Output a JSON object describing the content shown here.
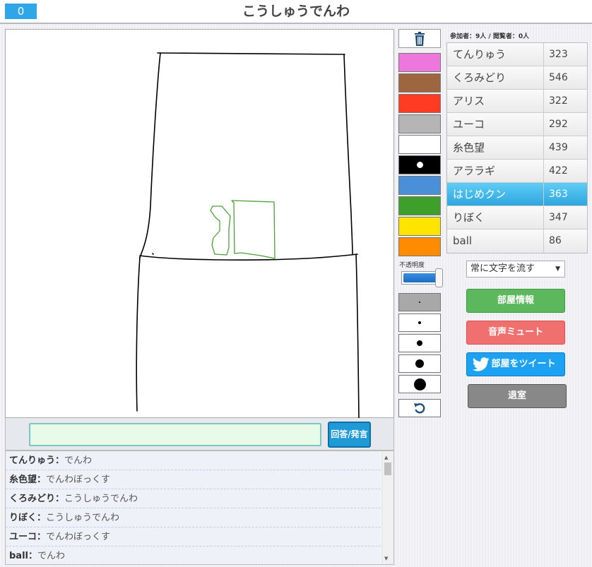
{
  "header": {
    "counter": "0",
    "title": "こうしゅうでんわ"
  },
  "tools": {
    "trash_icon": "trash-icon",
    "colors": [
      "#ee77dd",
      "#9e6640",
      "#ff3b24",
      "#b5b5b5",
      "#ffffff",
      "#000000",
      "#4a90d9",
      "#3ea02a",
      "#ffe400",
      "#ff8c00"
    ],
    "selected_color": "#000000",
    "opacity_label": "不透明度",
    "opacity": 1.0,
    "brush_sizes": [
      "size-1",
      "size-2",
      "size-3",
      "size-4",
      "size-5"
    ],
    "selected_brush": 0,
    "undo_icon": "undo-icon"
  },
  "room": {
    "participants": "参加者：9人 / 閲覧者：0人",
    "players": [
      {
        "name": "てんりゅう",
        "score": "323"
      },
      {
        "name": "くろみどり",
        "score": "546"
      },
      {
        "name": "アリス",
        "score": "322"
      },
      {
        "name": "ユーコ",
        "score": "292"
      },
      {
        "name": "糸色望",
        "score": "439"
      },
      {
        "name": "アララギ",
        "score": "422"
      },
      {
        "name": "はじめクン",
        "score": "363"
      },
      {
        "name": "りぼく",
        "score": "347"
      },
      {
        "name": "ball",
        "score": "86"
      }
    ],
    "active_player": 6,
    "text_mode": "常に文字を流す",
    "info_button": "部屋情報",
    "mute_button": "音声ミュート",
    "tweet_button": "部屋をツイート",
    "exit_button": "退室"
  },
  "answer": {
    "value": "",
    "button": "回答/発言"
  },
  "chat": [
    {
      "who": "てんりゅう",
      "msg": "でんわ"
    },
    {
      "who": "糸色望",
      "msg": "でんわぼっくす"
    },
    {
      "who": "くろみどり",
      "msg": "こうしゅうでんわ"
    },
    {
      "who": "りぼく",
      "msg": "こうしゅうでんわ"
    },
    {
      "who": "ユーコ",
      "msg": "でんわぼっくす"
    },
    {
      "who": "ball",
      "msg": "でんわ"
    }
  ]
}
